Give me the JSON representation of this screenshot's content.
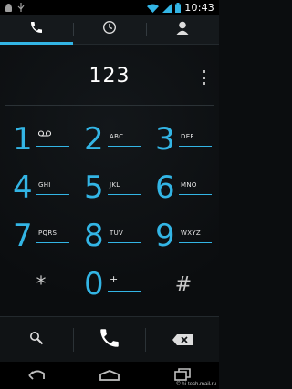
{
  "status_bar": {
    "time": "10:43",
    "icons": [
      "android-notification-icon",
      "usb-icon",
      "wifi-icon",
      "signal-icon",
      "battery-icon"
    ]
  },
  "tabs": [
    {
      "name": "phone-icon",
      "active": true
    },
    {
      "name": "recent-clock-icon",
      "active": false
    },
    {
      "name": "contacts-icon",
      "active": false
    }
  ],
  "dialer": {
    "number": "123"
  },
  "keypad": [
    {
      "digit": "1",
      "sub": "voicemail-icon"
    },
    {
      "digit": "2",
      "sub": "ABC"
    },
    {
      "digit": "3",
      "sub": "DEF"
    },
    {
      "digit": "4",
      "sub": "GHI"
    },
    {
      "digit": "5",
      "sub": "JKL"
    },
    {
      "digit": "6",
      "sub": "MNO"
    },
    {
      "digit": "7",
      "sub": "PQRS"
    },
    {
      "digit": "8",
      "sub": "TUV"
    },
    {
      "digit": "9",
      "sub": "WXYZ"
    },
    {
      "digit": "*",
      "sub": ""
    },
    {
      "digit": "0",
      "sub": "+"
    },
    {
      "digit": "#",
      "sub": ""
    }
  ],
  "actions": [
    "search-icon",
    "call-icon",
    "backspace-icon"
  ],
  "nav": [
    "back-icon",
    "home-icon",
    "recent-apps-icon"
  ],
  "watermark": "© hi-tech.mail.ru",
  "colors": {
    "accent": "#33b5e5",
    "background": "#0b0d0f"
  }
}
